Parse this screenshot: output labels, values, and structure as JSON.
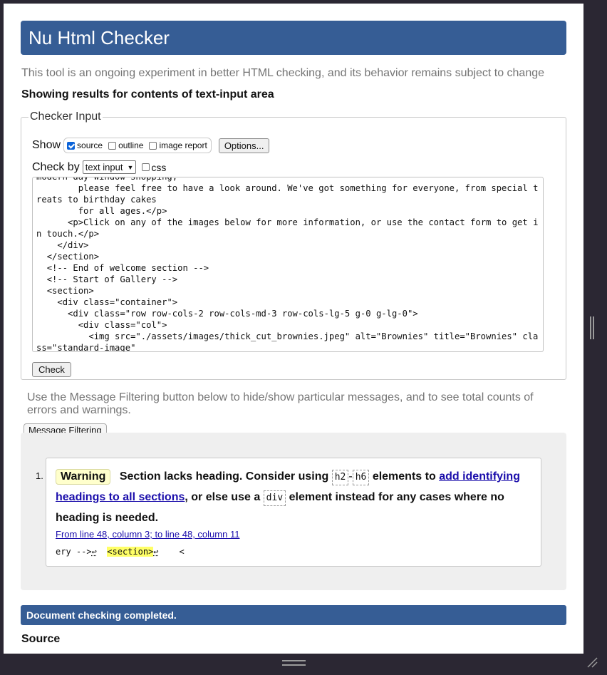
{
  "header": {
    "title": "Nu Html Checker"
  },
  "intro": {
    "text": "This tool is an ongoing experiment in better HTML checking, and its behavior remains subject to change"
  },
  "showing": {
    "text": "Showing results for contents of text-input area"
  },
  "checker": {
    "legend": "Checker Input",
    "show_label": "Show",
    "options": [
      {
        "label": "source",
        "checked": true
      },
      {
        "label": "outline",
        "checked": false
      },
      {
        "label": "image report",
        "checked": false
      }
    ],
    "options_button": "Options...",
    "checkby_label": "Check by",
    "checkby_value": "text input",
    "css_label": "css",
    "css_checked": false,
    "source_text": "modern-day window-shopping,\n        please feel free to have a look around. We've got something for everyone, from special treats to birthday cakes\n        for all ages.</p>\n      <p>Click on any of the images below for more information, or use the contact form to get in touch.</p>\n    </div>\n  </section>\n  <!-- End of welcome section -->\n  <!-- Start of Gallery -->\n  <section>\n    <div class=\"container\">\n      <div class=\"row row-cols-2 row-cols-md-3 row-cols-lg-5 g-0 g-lg-0\">\n        <div class=\"col\">\n          <img src=\"./assets/images/thick_cut_brownies.jpeg\" alt=\"Brownies\" title=\"Brownies\" class=\"standard-image\"",
    "check_button": "Check"
  },
  "filter": {
    "note": "Use the Message Filtering button below to hide/show particular messages, and to see total counts of errors and warnings.",
    "button": "Message Filtering"
  },
  "results": {
    "messages": [
      {
        "number": "1.",
        "type": "Warning",
        "text_1": "Section lacks heading. Consider using",
        "code_1": "h2",
        "dash": "-",
        "code_2": "h6",
        "text_2": "elements to",
        "link": "add identifying headings to all sections",
        "text_3": ", or else use a",
        "code_3": "div",
        "text_4": "element instead for any cases where no heading is needed.",
        "location": "From line 48, column 3; to line 48, column 11",
        "extract_before": "ery -->",
        "extract_highlight": "<section>",
        "extract_after": "<"
      }
    ]
  },
  "completed": {
    "text": "Document checking completed."
  },
  "source_heading": {
    "text": "Source"
  },
  "colors": {
    "header_bg": "#365d95",
    "warning_bg": "#ffffcc",
    "highlight": "#ffff66"
  }
}
